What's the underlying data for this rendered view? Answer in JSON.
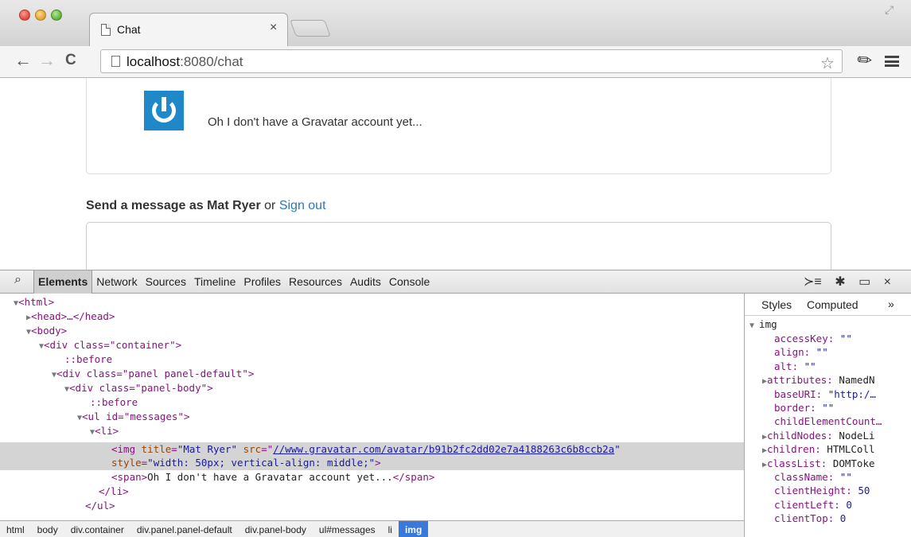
{
  "browser": {
    "tab_title": "Chat",
    "tab_close": "×",
    "url_host": "localhost",
    "url_rest": ":8080/chat"
  },
  "page": {
    "message_text": "Oh I don't have a Gravatar account yet...",
    "send_prefix": "Send a message as",
    "user_name": "Mat Ryer",
    "or_text": "or",
    "sign_out": "Sign out"
  },
  "devtools": {
    "tabs": [
      "Elements",
      "Network",
      "Sources",
      "Timeline",
      "Profiles",
      "Resources",
      "Audits",
      "Console"
    ],
    "active_tab": "Elements",
    "close": "×",
    "dom": {
      "html_open": "<html>",
      "head": "<head>…</head>",
      "body_open": "<body>",
      "div_container": "<div class=\"container\">",
      "before1": "::before",
      "div_panel": "<div class=\"panel panel-default\">",
      "div_panel_body": "<div class=\"panel-body\">",
      "before2": "::before",
      "ul_messages": "<ul id=\"messages\">",
      "li_open": "<li>",
      "img_title_attr": "title",
      "img_title_val": "\"Mat Ryer\"",
      "img_src_attr": "src",
      "img_src_val": "//www.gravatar.com/avatar/b91b2fc2dd02e7a4188263c6b8ccb2a",
      "img_style_attr": "style",
      "img_style_val": "\"width: 50px; vertical-align: middle;\"",
      "span_line": "Oh I don't have a Gravatar account yet...",
      "li_close": "</li>",
      "ul_close": "</ul>"
    },
    "breadcrumbs": [
      "html",
      "body",
      "div.container",
      "div.panel.panel-default",
      "div.panel-body",
      "ul#messages",
      "li",
      "img"
    ],
    "styles_tab": "Styles",
    "computed_tab": "Computed",
    "more": "»",
    "element": "img",
    "properties": [
      {
        "name": "accessKey",
        "value": "\"\"",
        "expandable": false
      },
      {
        "name": "align",
        "value": "\"\"",
        "expandable": false
      },
      {
        "name": "alt",
        "value": "\"\"",
        "expandable": false
      },
      {
        "name": "attributes",
        "value": "NamedN",
        "expandable": true
      },
      {
        "name": "baseURI",
        "value": "\"http:/…",
        "expandable": false
      },
      {
        "name": "border",
        "value": "\"\"",
        "expandable": false
      },
      {
        "name": "childElementCount…",
        "value": "",
        "expandable": false
      },
      {
        "name": "childNodes",
        "value": "NodeLi",
        "expandable": true
      },
      {
        "name": "children",
        "value": "HTMLColl",
        "expandable": true
      },
      {
        "name": "classList",
        "value": "DOMToke",
        "expandable": true
      },
      {
        "name": "className",
        "value": "\"\"",
        "expandable": false
      },
      {
        "name": "clientHeight",
        "value": "50",
        "expandable": false
      },
      {
        "name": "clientLeft",
        "value": "0",
        "expandable": false
      },
      {
        "name": "clientTop",
        "value": "0",
        "expandable": false
      }
    ]
  }
}
